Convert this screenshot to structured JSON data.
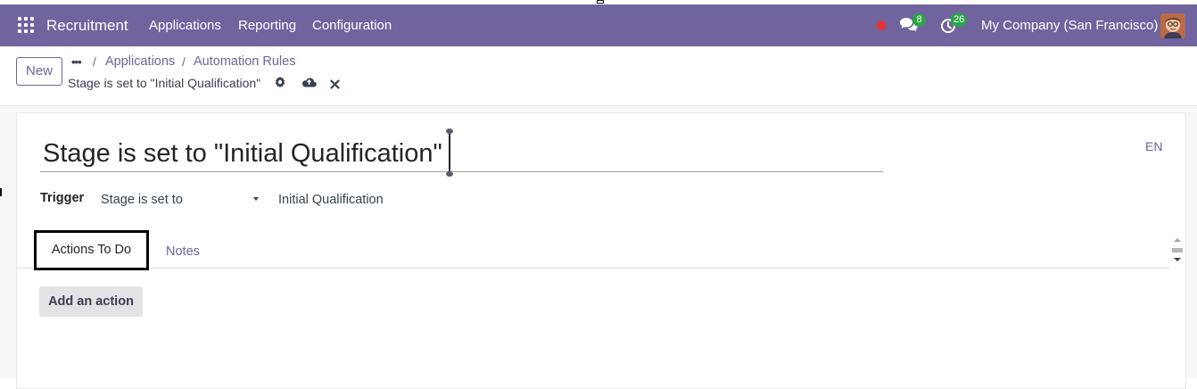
{
  "navbar": {
    "app_name": "Recruitment",
    "menu": [
      "Applications",
      "Reporting",
      "Configuration"
    ],
    "messages_count": "8",
    "activities_count": "26",
    "company": "My Company (San Francisco)",
    "bg_color": "#71639e"
  },
  "control_panel": {
    "new_label": "New",
    "more_label": "•••",
    "breadcrumbs": [
      "Applications",
      "Automation Rules"
    ],
    "record_name": "Stage is set to \"Initial Qualification\""
  },
  "form": {
    "title": "Stage is set to \"Initial Qualification\"",
    "lang": "EN",
    "trigger_label": "Trigger",
    "trigger_value": "Stage is set to",
    "stage_value": "Initial Qualification",
    "tabs": [
      "Actions To Do",
      "Notes"
    ],
    "add_action_label": "Add an action"
  },
  "icons": {
    "apps": "apps-grid-icon",
    "record": "record-dot-icon",
    "chat": "chat-bubbles-icon",
    "activity": "clock-activity-icon",
    "settings": "gear-icon",
    "save": "cloud-upload-icon",
    "discard": "close-icon"
  }
}
